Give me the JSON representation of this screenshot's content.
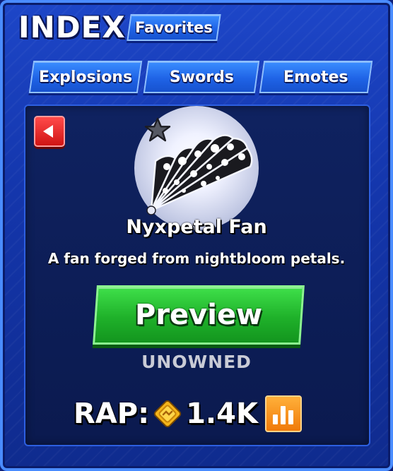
{
  "header": {
    "title": "INDEX",
    "favorites_label": "Favorites"
  },
  "categories": [
    {
      "label": "Explosions"
    },
    {
      "label": "Swords"
    },
    {
      "label": "Emotes"
    }
  ],
  "item": {
    "name": "Nyxpetal Fan",
    "description": "A fan forged from nightbloom petals.",
    "preview_label": "Preview",
    "status": "UNOWNED",
    "rap_label": "RAP:",
    "rap_value": "1.4K"
  },
  "icons": {
    "back": "back-arrow-icon",
    "favorite": "star-icon",
    "currency": "coin-icon",
    "stats": "bar-chart-icon"
  },
  "colors": {
    "panel": "#1436ac",
    "preview_button": "#1fb12a",
    "back_button": "#d01414",
    "stats_button": "#f07a0a",
    "status_text": "#c9cbd6"
  }
}
